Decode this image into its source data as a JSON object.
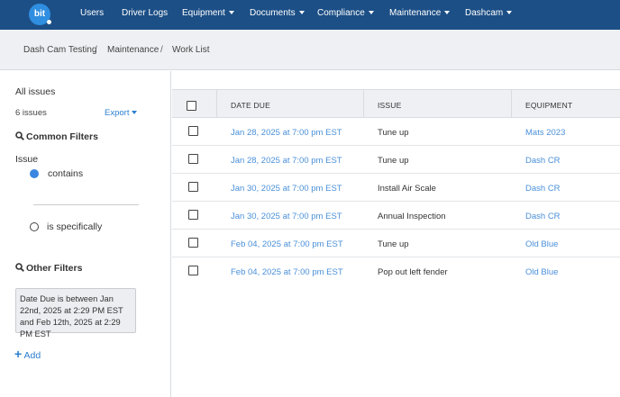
{
  "topnav": {
    "logo_text": "bit",
    "items": [
      "Users",
      "Driver Logs",
      "Equipment",
      "Documents",
      "Compliance",
      "Maintenance",
      "Dashcam"
    ]
  },
  "breadcrumb": [
    "Dash Cam Testing",
    "Maintenance",
    "Work List"
  ],
  "breadcrumb_separator": "/",
  "sidebar": {
    "title": "All issues",
    "count": "6 issues",
    "export_label": "Export",
    "common_filters_title": "Common Filters",
    "issue_label": "Issue",
    "option_contains": "contains",
    "option_specifically": "is specifically",
    "other_filters_title": "Other Filters",
    "filter_text": "Date Due is between Jan 22nd, 2025 at 2:29 PM EST and Feb 12th, 2025 at 2:29 PM EST",
    "add_label": "Add"
  },
  "table": {
    "headers": [
      "DATE DUE",
      "ISSUE",
      "EQUIPMENT"
    ],
    "rows": [
      {
        "date": "Jan 28, 2025 at 7:00 pm EST",
        "issue": "Tune up",
        "equipment": "Mats 2023"
      },
      {
        "date": "Jan 28, 2025 at 7:00 pm EST",
        "issue": "Tune up",
        "equipment": "Dash CR"
      },
      {
        "date": "Jan 30, 2025 at 7:00 pm EST",
        "issue": "Install Air Scale",
        "equipment": "Dash CR"
      },
      {
        "date": "Jan 30, 2025 at 7:00 pm EST",
        "issue": "Annual Inspection",
        "equipment": "Dash CR"
      },
      {
        "date": "Feb 04, 2025 at 7:00 pm EST",
        "issue": "Tune up",
        "equipment": "Old Blue"
      },
      {
        "date": "Feb 04, 2025 at 7:00 pm EST",
        "issue": "Pop out left fender",
        "equipment": "Old Blue"
      }
    ]
  },
  "colors": {
    "nav_bg": "#1c4f86",
    "link": "#4a90d9",
    "accent": "#3b86e0"
  }
}
